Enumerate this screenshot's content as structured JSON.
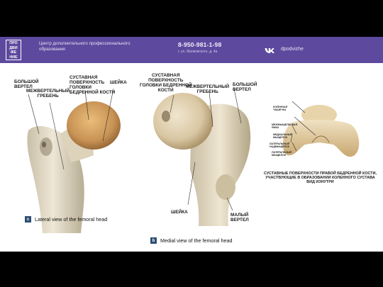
{
  "header": {
    "logo_lines": [
      "ПРО",
      "ДВИ",
      "ЖЕ",
      "НИЕ"
    ],
    "center_name_line1": "Центр дополнительного профессионального",
    "center_name_line2": "образования",
    "phone": "8-950-981-1-98",
    "address": "г. ул. Маяковского, д. 4а",
    "social_icon": "vk-icon",
    "social_handle": "dpodvizhe"
  },
  "figure_left": {
    "labels": {
      "greater_trochanter": "БОЛЬШОЙ\nВЕРТЕЛ",
      "intertrochanteric_crest": "МЕЖВЕРТЕЛЬНЫЙ\nГРЕБЕНЬ",
      "articular_surface": "СУСТАВНАЯ\nПОВЕРХНОСТЬ\nГОЛОВКИ\nБЕДРЕННОЙ КОСТИ",
      "neck": "ШЕЙКА"
    },
    "caption_letter": "c",
    "caption": "Lateral view of the femoral head"
  },
  "figure_middle": {
    "labels": {
      "articular_surface": "СУСТАВНАЯ\nПОВЕРХНОСТЬ\nГОЛОВКИ БЕДРЕННОЙ\nКОСТИ",
      "intertrochanteric_crest": "МЕЖВЕРТЕЛЬНЫЙ\nГРЕБЕНЬ",
      "greater_trochanter": "БОЛЬШОЙ\nВЕРТЕЛ",
      "neck": "ШЕЙКА",
      "lesser_trochanter": "МАЛЫЙ\nВЕРТЕЛ"
    },
    "caption_letter": "b",
    "caption": "Medial view of the femoral head"
  },
  "figure_right": {
    "small_labels": {
      "patella": "КОЛЕННАЯ\nЧАШЕЧКА",
      "intercondylar": "МЕЖМЫЩЕЛКОВАЯ\nЯМКА",
      "medial_condyle": "МЕДИАЛЬНЫЙ\nМЫЩЕЛОК",
      "lateral_epicondyle": "ЛАТЕРАЛЬНЫЙ\nНАДМЫЩЕЛОК",
      "lateral_condyle": "ЛАТЕРАЛЬНЫЙ\nМЫЩЕЛОК"
    },
    "caption": "СУСТАВНЫЕ ПОВЕРХНОСТИ ПРАВОЙ БЕДРЕННОЙ КОСТИ,\nУЧАСТВУЮЩИЕ В ОБРАЗОВАНИИ КОЛЕННОГО СУСТАВА\nВИД ИЗНУТРИ"
  }
}
